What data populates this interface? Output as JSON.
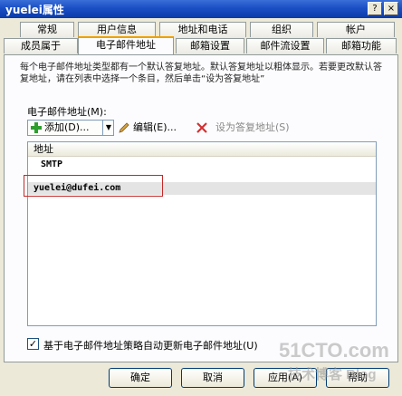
{
  "window": {
    "title": "yuelei属性",
    "help_btn": "?",
    "close_btn": "×"
  },
  "tabs_row1": [
    "常规",
    "用户信息",
    "地址和电话",
    "组织",
    "帐户"
  ],
  "tabs_row2": [
    "成员属于",
    "电子邮件地址",
    "邮箱设置",
    "邮件流设置",
    "邮箱功能"
  ],
  "description": "每个电子邮件地址类型都有一个默认答复地址。默认答复地址以粗体显示。若要更改默认答复地址，请在列表中选择一个条目，然后单击“设为答复地址”",
  "addresses_label": "电子邮件地址(M):",
  "toolbar": {
    "add": "添加(D)...",
    "edit": "编辑(E)...",
    "set_reply": "设为答复地址(S)"
  },
  "list": {
    "header": "地址",
    "group": "SMTP",
    "items": [
      "yuelei@dufei.com"
    ]
  },
  "auto_update": {
    "label": "基于电子邮件地址策略自动更新电子邮件地址(U)",
    "checked": "✓"
  },
  "buttons": {
    "ok": "确定",
    "cancel": "取消",
    "apply": "应用(A)",
    "help": "帮助"
  },
  "watermark": {
    "main": "51CTO.com",
    "sub": "技术博客 Blog"
  },
  "colors": {
    "tab_highlight": "#f0a000",
    "callout_border": "#c62828",
    "titlebar": "#1a4fc4"
  }
}
